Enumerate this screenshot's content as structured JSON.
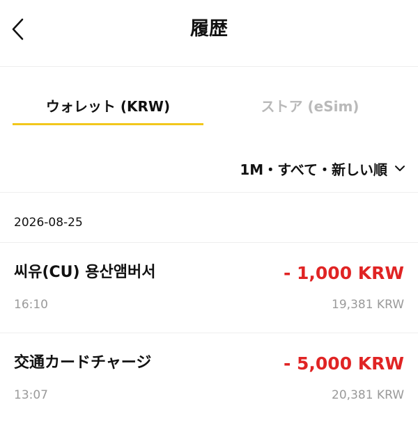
{
  "header": {
    "title": "履歴",
    "back_icon": "chevron-left-icon"
  },
  "tabs": [
    {
      "label": "ウォレット (KRW)",
      "active": true
    },
    {
      "label": "ストア (eSim)",
      "active": false
    }
  ],
  "colors": {
    "accent": "#f2c71b",
    "negative_amount": "#e02424",
    "muted_text": "#9a9a9a",
    "inactive_tab": "#b9b9b9"
  },
  "filter": {
    "label": "1M・すべて・新しい順",
    "icon": "chevron-down-icon"
  },
  "groups": [
    {
      "date": "2026-08-25",
      "transactions": [
        {
          "name": "씨유(CU) 용산앰버서",
          "time": "16:10",
          "amount": "- 1,000 KRW",
          "balance": "19,381 KRW"
        },
        {
          "name": "交通カードチャージ",
          "time": "13:07",
          "amount": "- 5,000 KRW",
          "balance": "20,381 KRW"
        }
      ]
    }
  ]
}
